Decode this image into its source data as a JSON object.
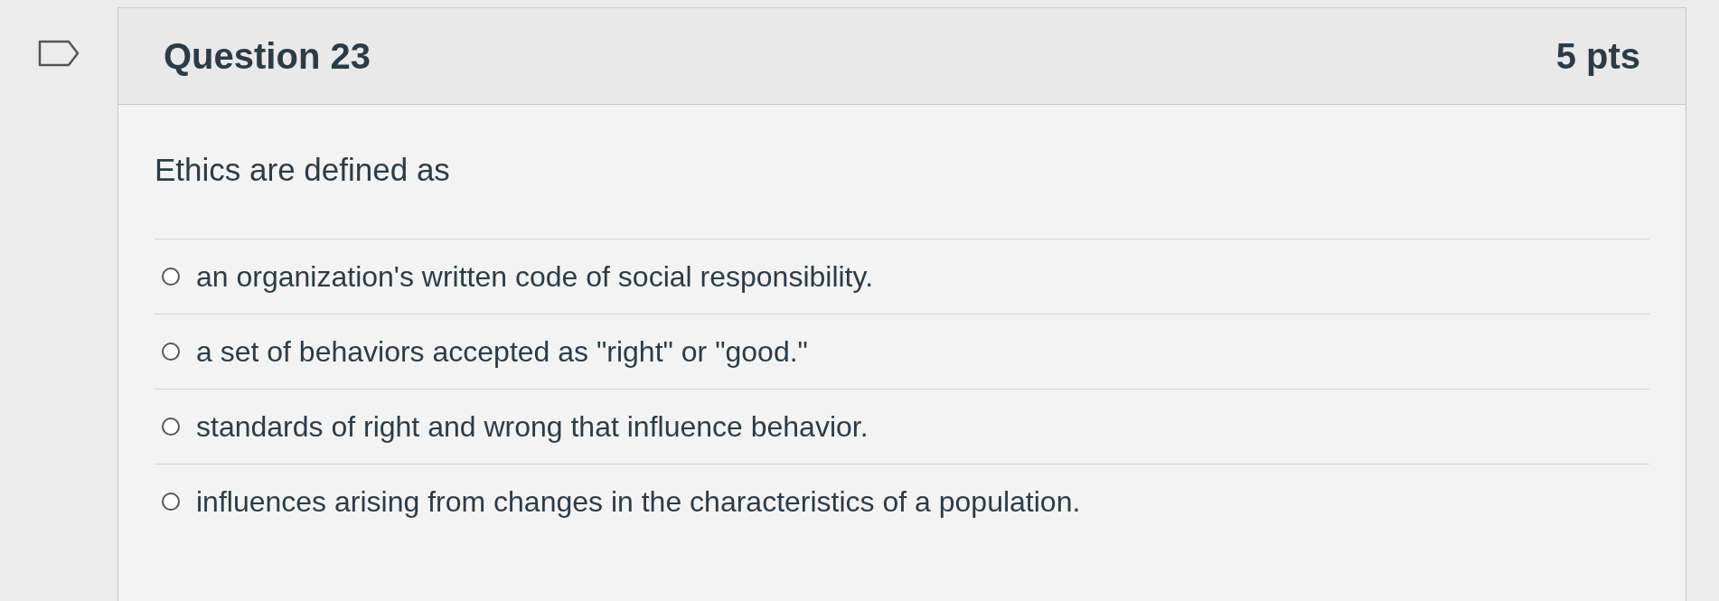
{
  "question": {
    "title": "Question 23",
    "points": "5 pts",
    "flagged": false
  },
  "prompt": "Ethics are defined as",
  "options": [
    {
      "label": "an organization's written code of social responsibility.",
      "selected": false
    },
    {
      "label": "a set of behaviors accepted as \"right\" or \"good.\"",
      "selected": false
    },
    {
      "label": "standards of right and wrong that influence behavior.",
      "selected": false
    },
    {
      "label": "influences arising from changes in the characteristics of a population.",
      "selected": false
    }
  ]
}
